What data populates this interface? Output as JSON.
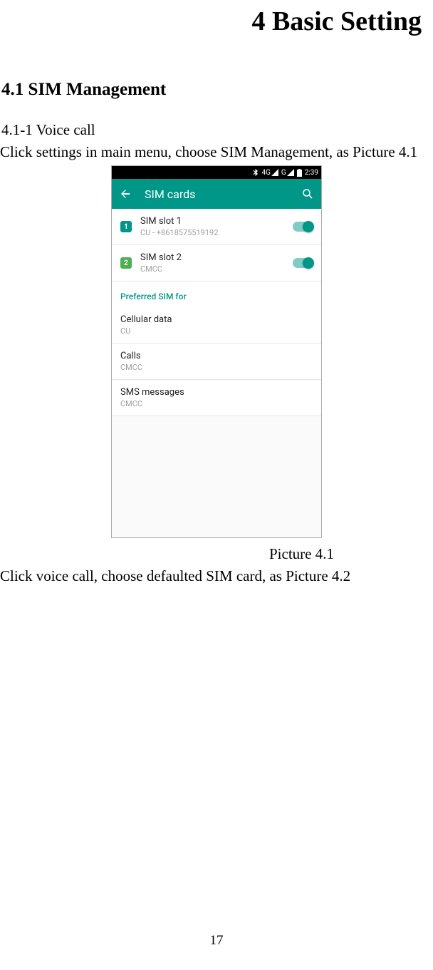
{
  "chapter_title": "4 Basic Setting",
  "section": "4.1 SIM Management",
  "subsection": "4.1-1 Voice call",
  "intro_text": "Click settings in main menu, choose SIM Management, as Picture 4.1",
  "screenshot": {
    "statusbar": {
      "net1": "4G",
      "net2": "G",
      "time": "2:39"
    },
    "appbar_title": "SIM cards",
    "sim_slots": [
      {
        "badge": "1",
        "name": "SIM slot 1",
        "detail": "CU - +8618575519192"
      },
      {
        "badge": "2",
        "name": "SIM slot 2",
        "detail": "CMCC"
      }
    ],
    "pref_header": "Preferred SIM for",
    "prefs": [
      {
        "label": "Cellular data",
        "value": "CU"
      },
      {
        "label": "Calls",
        "value": "CMCC"
      },
      {
        "label": "SMS messages",
        "value": "CMCC"
      }
    ]
  },
  "figure_caption": "Picture 4.1",
  "follow_text": "Click voice call, choose defaulted SIM card, as Picture 4.2",
  "page_number": "17"
}
